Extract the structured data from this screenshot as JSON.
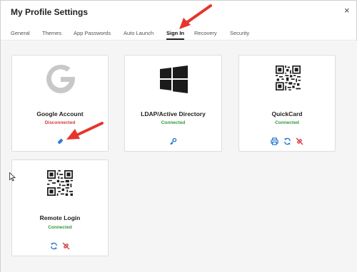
{
  "window": {
    "title": "My Profile Settings",
    "close_glyph": "×"
  },
  "tabs": [
    {
      "label": "General"
    },
    {
      "label": "Themes"
    },
    {
      "label": "App Passwords"
    },
    {
      "label": "Auto Launch"
    },
    {
      "label": "Sign In",
      "active": true
    },
    {
      "label": "Recovery"
    },
    {
      "label": "Security"
    }
  ],
  "cards": [
    {
      "name": "Google Account",
      "status": "Disconnected",
      "logo": "google-logo",
      "actions": [
        "link-icon"
      ]
    },
    {
      "name": "LDAP/Active Directory",
      "status": "Connected",
      "logo": "windows-logo",
      "actions": [
        "key-icon"
      ]
    },
    {
      "name": "QuickCard",
      "status": "Connected",
      "logo": "qr-code",
      "actions": [
        "print-icon",
        "refresh-icon",
        "unlink-icon"
      ]
    },
    {
      "name": "Remote Login",
      "status": "Connected",
      "logo": "qr-code",
      "actions": [
        "refresh-icon",
        "unlink-icon"
      ]
    }
  ],
  "colors": {
    "disconnected": "#d23a3a",
    "connected": "#2e9a3a",
    "action_blue": "#1f6fd6",
    "unlink_red": "#d23a3a",
    "annotation_arrow": "#e5352c"
  }
}
